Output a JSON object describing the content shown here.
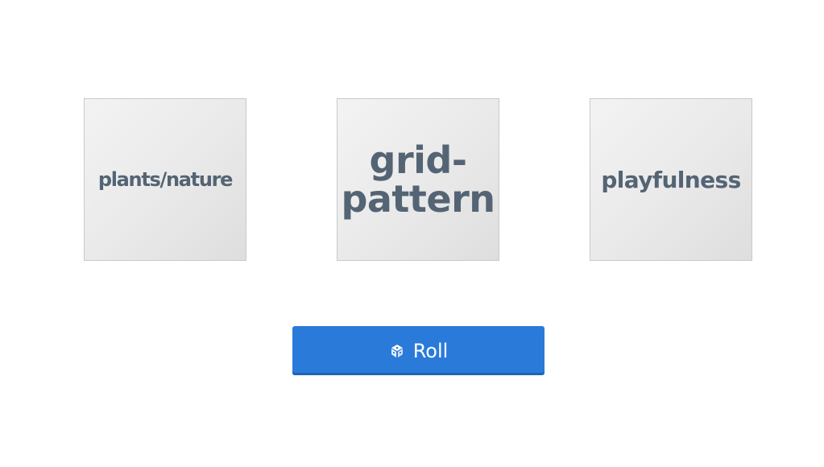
{
  "cards": [
    {
      "label": "plants/nature"
    },
    {
      "label": "grid-pattern"
    },
    {
      "label": "playfulness"
    }
  ],
  "roll_button": {
    "label": "Roll",
    "icon": "dice-icon",
    "color": "#2a7ad9"
  },
  "colors": {
    "card_text": "#546474",
    "card_background": "#eeeeee",
    "card_border": "#c9c9c9"
  }
}
